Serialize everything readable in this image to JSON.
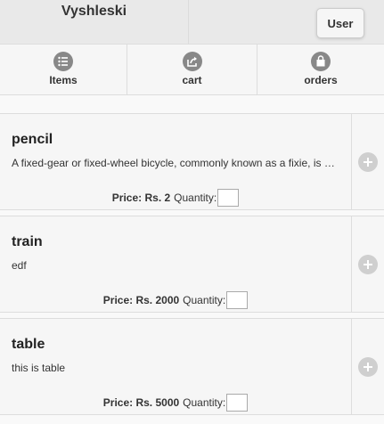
{
  "header": {
    "title": "Vyshleski",
    "user_button": "User"
  },
  "nav": [
    {
      "label": "Items",
      "icon": "list-icon"
    },
    {
      "label": "cart",
      "icon": "share-icon"
    },
    {
      "label": "orders",
      "icon": "bag-icon"
    }
  ],
  "items": [
    {
      "name": "pencil",
      "description": "A fixed-gear or fixed-wheel bicycle, commonly known as a fixie, is a bicycle that has no freewheel",
      "price": "Price: Rs. 2",
      "quantity_label": "Quantity:",
      "quantity": ""
    },
    {
      "name": "train",
      "description": "edf",
      "price": "Price: Rs. 2000",
      "quantity_label": "Quantity:",
      "quantity": ""
    },
    {
      "name": "table",
      "description": "this is table",
      "price": "Price: Rs. 5000",
      "quantity_label": "Quantity:",
      "quantity": ""
    }
  ],
  "colors": {
    "icon": "#888888",
    "add_icon": "#cfcfcf"
  }
}
